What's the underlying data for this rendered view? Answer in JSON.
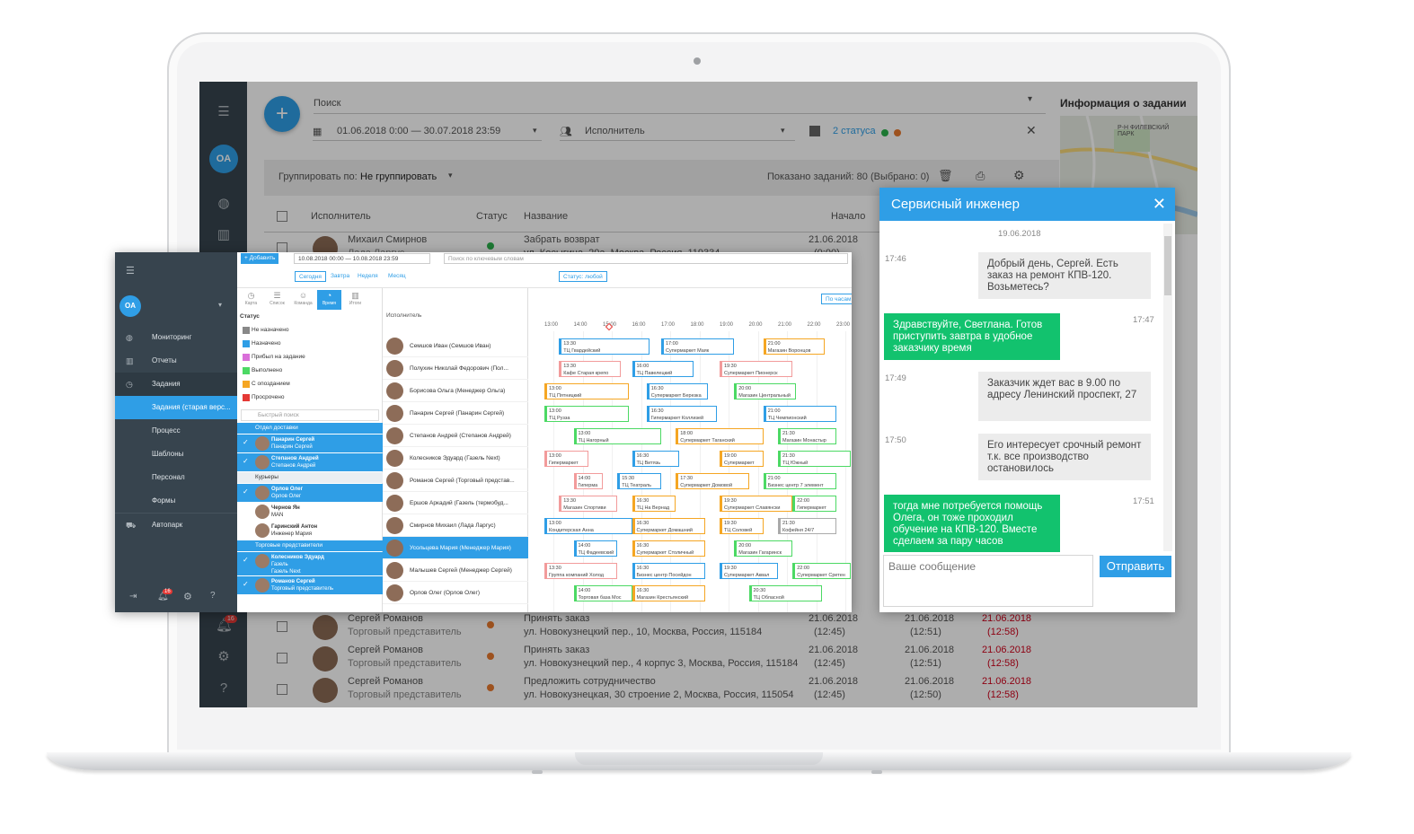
{
  "bg": {
    "avatar_initials": "OA",
    "search_placeholder": "Поиск",
    "date_range": "01.06.2018 0:00 — 30.07.2018 23:59",
    "executor_placeholder": "Исполнитель",
    "status_filter": "2 статуса",
    "group_by_label": "Группировать по:",
    "group_by_value": "Не группировать",
    "shown_count": "Показано заданий: 80 (Выбрано: 0)",
    "columns": {
      "executor": "Исполнитель",
      "status": "Статус",
      "title": "Название",
      "start": "Начало"
    },
    "info_title": "Информация о задании",
    "map_label": "Р-Н ФИЛЕВСКИЙ ПАРК",
    "notif_badge": "16",
    "rows": [
      {
        "name": "Михаил Смирнов",
        "role": "Лада Ларгус",
        "title": "Забрать возврат",
        "address": "ул. Косыгина, 20а, Москва, Россия, 119334",
        "start": "21.06.2018",
        "start_time": "(0:00)",
        "status_color": "#2bb24c"
      },
      {
        "name": "Сергей Романов",
        "role": "Торговый представитель",
        "title": "Принять заказ",
        "address": "ул. Новокузнецкий пер., 10, Москва, Россия, 115184",
        "start": "21.06.2018",
        "start_time": "(12:45)",
        "c2": "21.06.2018",
        "c2_time": "(12:51)",
        "c3": "21.06.2018",
        "c3_time": "(12:58)",
        "status_color": "#e8792e"
      },
      {
        "name": "Сергей Романов",
        "role": "Торговый представитель",
        "title": "Принять заказ",
        "address": "ул. Новокузнецкий пер., 4 корпус 3, Москва, Россия, 115184",
        "start": "21.06.2018",
        "start_time": "(12:45)",
        "c2": "21.06.2018",
        "c2_time": "(12:51)",
        "c3": "21.06.2018",
        "c3_time": "(12:58)",
        "status_color": "#e8792e"
      },
      {
        "name": "Сергей Романов",
        "role": "Торговый представитель",
        "title": "Предложить сотрудничество",
        "address": "ул. Новокузнецкая, 30 строение 2, Москва, Россия, 115054",
        "start": "21.06.2018",
        "start_time": "(12:45)",
        "c2": "21.06.2018",
        "c2_time": "(12:50)",
        "c3": "21.06.2018",
        "c3_time": "(12:58)",
        "status_color": "#e8792e"
      }
    ]
  },
  "win": {
    "avatar_initials": "OA",
    "nav": [
      {
        "label": "Мониторинг",
        "icon": "globe-icon"
      },
      {
        "label": "Отчеты",
        "icon": "chart-icon"
      },
      {
        "label": "Задания",
        "icon": "clock-icon"
      },
      {
        "label": "Задания (старая верс...",
        "icon": ""
      },
      {
        "label": "Процесс",
        "icon": ""
      },
      {
        "label": "Шаблоны",
        "icon": ""
      },
      {
        "label": "Персонал",
        "icon": ""
      },
      {
        "label": "Формы",
        "icon": ""
      },
      {
        "label": "Автопарк",
        "icon": "car-icon"
      }
    ],
    "notif_badge": "16",
    "add_button": "Добавить",
    "date_range": "10.08.2018 00:00 — 10.08.2018 23:59",
    "keyword_placeholder": "Поиск по ключевым словам",
    "quick_dates": [
      "Сегодня",
      "Завтра",
      "Неделя",
      "Месяц"
    ],
    "status_any": "Статус: любой",
    "by_hours": "По часам",
    "view_tabs": [
      "Карта",
      "Список",
      "Команда",
      "Время",
      "Итоги"
    ],
    "status_header": "Статус",
    "statuses": [
      {
        "label": "Не назначено",
        "color": "#888888"
      },
      {
        "label": "Назначено",
        "color": "#2f9ee6"
      },
      {
        "label": "Прибыл на задание",
        "color": "#d96fd9"
      },
      {
        "label": "Выполнено",
        "color": "#4cd964"
      },
      {
        "label": "С опозданием",
        "color": "#f5a623"
      },
      {
        "label": "Просрочено",
        "color": "#e53935"
      }
    ],
    "quick_search": "Быстрый поиск",
    "groups": [
      {
        "title": "Отдел доставки",
        "people": [
          {
            "name": "Панарин Сергей",
            "sub": "Панарин Сергей"
          },
          {
            "name": "Степанов Андрей",
            "sub": "Степанов Андрей"
          }
        ]
      },
      {
        "title": "Курьеры",
        "people": [
          {
            "name": "Орлов Олег",
            "sub": "Орлов Олег"
          },
          {
            "name": "Чернов Ян",
            "sub": "MAN"
          },
          {
            "name": "Гаринский Антон",
            "sub": "Инженер Мария"
          }
        ]
      },
      {
        "title": "Торговые представители",
        "people": [
          {
            "name": "Колесников Эдуард",
            "sub": "Газель",
            "sub2": "Газель Next"
          },
          {
            "name": "Романов Сергей",
            "sub": "Торговый представитель"
          }
        ]
      }
    ],
    "executor_header": "Исполнитель",
    "hours": [
      "13:00",
      "14:00",
      "15:00",
      "16:00",
      "17:00",
      "18:00",
      "19:00",
      "20:00",
      "21:00",
      "22:00",
      "23:00"
    ],
    "executors": [
      "Семшов Иван (Семшов Иван)",
      "Полухин Николай Федорович (Пол...",
      "Борисова Ольга (Менеджер Ольга)",
      "Панарин Сергей (Панарин Сергей)",
      "Степанов Андрей (Степанов Андрей)",
      "Колесников Эдуард (Газель Next)",
      "Романов Сергей (Торговый представ...",
      "Ершов Аркадий (Газель (термобуд...",
      "Смирнов Михаил (Лада Ларгус)",
      "Усольцева Мария (Менеджер Мария)",
      "Малышев Сергей (Менеджер Сергей)",
      "Орлов Олег (Орлов Олег)"
    ],
    "blocks": [
      [
        {
          "t": "13:30",
          "n": "ТЦ Гвардейский",
          "c": "blue",
          "s": 13.5,
          "e": 16.6
        },
        {
          "t": "17:00",
          "n": "Супермаркет Маяк",
          "c": "blue",
          "s": 17.0,
          "e": 19.5
        },
        {
          "t": "21:00",
          "n": "Магазин Воронцов",
          "c": "orange",
          "s": 20.5,
          "e": 22.6
        }
      ],
      [
        {
          "t": "13:30",
          "n": "Кафе Старая крепо",
          "c": "red",
          "s": 13.5,
          "e": 15.6
        },
        {
          "t": "16:00",
          "n": "ТЦ Павелецкий",
          "c": "blue",
          "s": 16.0,
          "e": 18.1
        },
        {
          "t": "19:30",
          "n": "Супермаркет Пионерск",
          "c": "red",
          "s": 19.0,
          "e": 21.5
        }
      ],
      [
        {
          "t": "13:00",
          "n": "ТЦ Пятницкий",
          "c": "orange",
          "s": 13.0,
          "e": 15.9
        },
        {
          "t": "16:30",
          "n": "Супермаркет Березка",
          "c": "blue",
          "s": 16.5,
          "e": 18.6
        },
        {
          "t": "20:00",
          "n": "Магазин Центральный",
          "c": "green",
          "s": 19.5,
          "e": 21.6
        }
      ],
      [
        {
          "t": "13:00",
          "n": "ТЦ Рузза",
          "c": "green",
          "s": 13.0,
          "e": 15.9
        },
        {
          "t": "16:30",
          "n": "Гипермаркет Коллизей",
          "c": "blue",
          "s": 16.5,
          "e": 18.9
        },
        {
          "t": "21:00",
          "n": "ТЦ Чемпионский",
          "c": "blue",
          "s": 20.5,
          "e": 23.0
        }
      ],
      [
        {
          "t": "13:00",
          "n": "ТЦ Нагорный",
          "c": "green",
          "s": 14.0,
          "e": 17.0
        },
        {
          "t": "18:00",
          "n": "Супермаркет Таганский",
          "c": "orange",
          "s": 17.5,
          "e": 20.5
        },
        {
          "t": "21:30",
          "n": "Магазин Монастыр",
          "c": "green",
          "s": 21.0,
          "e": 23.0
        }
      ],
      [
        {
          "t": "13:00",
          "n": "Гипермаркет",
          "c": "red",
          "s": 13.0,
          "e": 14.5
        },
        {
          "t": "16:30",
          "n": "ТЦ Витязь",
          "c": "blue",
          "s": 16.0,
          "e": 17.6
        },
        {
          "t": "19:00",
          "n": "Супермаркет",
          "c": "orange",
          "s": 19.0,
          "e": 20.5
        },
        {
          "t": "21:30",
          "n": "ТЦ Южный",
          "c": "green",
          "s": 21.0,
          "e": 23.5
        }
      ],
      [
        {
          "t": "14:00",
          "n": "Гиперма",
          "c": "red",
          "s": 14.0,
          "e": 15.0
        },
        {
          "t": "15:30",
          "n": "ТЦ Театраль",
          "c": "blue",
          "s": 15.5,
          "e": 17.0
        },
        {
          "t": "17:30",
          "n": "Супермаркет Домовой",
          "c": "orange",
          "s": 17.5,
          "e": 20.0
        },
        {
          "t": "21:00",
          "n": "Бизнес центр 7 элемент",
          "c": "green",
          "s": 20.5,
          "e": 23.0
        }
      ],
      [
        {
          "t": "13:30",
          "n": "Магазин Спортиви",
          "c": "red",
          "s": 13.5,
          "e": 15.5
        },
        {
          "t": "16:30",
          "n": "ТЦ На Вернад",
          "c": "orange",
          "s": 16.0,
          "e": 17.5
        },
        {
          "t": "19:30",
          "n": "Супермаркет Славянски",
          "c": "orange",
          "s": 19.0,
          "e": 21.5
        },
        {
          "t": "22:00",
          "n": "Гипермаркет",
          "c": "green",
          "s": 21.5,
          "e": 23.0
        }
      ],
      [
        {
          "t": "13:00",
          "n": "Кондитерская Анна",
          "c": "blue",
          "s": 13.0,
          "e": 16.0
        },
        {
          "t": "16:30",
          "n": "Супермаркет Домашний",
          "c": "orange",
          "s": 16.0,
          "e": 18.5
        },
        {
          "t": "19:30",
          "n": "ТЦ Соловей",
          "c": "orange",
          "s": 19.0,
          "e": 20.5
        },
        {
          "t": "21:30",
          "n": "Кофейня 24/7",
          "c": "gray",
          "s": 21.0,
          "e": 23.0
        }
      ],
      [
        {
          "t": "14:00",
          "n": "ТЦ Фадеевский",
          "c": "blue",
          "s": 14.0,
          "e": 15.5
        },
        {
          "t": "16:30",
          "n": "Супермаркет Столичный",
          "c": "orange",
          "s": 16.0,
          "e": 18.5
        },
        {
          "t": "20:00",
          "n": "Магазин Гагаринск",
          "c": "green",
          "s": 19.5,
          "e": 21.5
        }
      ],
      [
        {
          "t": "13:30",
          "n": "Группа компаний Холод",
          "c": "red",
          "s": 13.0,
          "e": 15.5
        },
        {
          "t": "16:30",
          "n": "Бизнес центр Посейдон",
          "c": "blue",
          "s": 16.0,
          "e": 18.5
        },
        {
          "t": "19:30",
          "n": "Супермаркет Аквал",
          "c": "blue",
          "s": 19.0,
          "e": 21.0
        },
        {
          "t": "22:00",
          "n": "Супермаркет Сретен",
          "c": "green",
          "s": 21.5,
          "e": 23.5
        }
      ],
      [
        {
          "t": "14:00",
          "n": "Торговая база Мос",
          "c": "green",
          "s": 14.0,
          "e": 16.0
        },
        {
          "t": "16:30",
          "n": "Магазин Крестьянский",
          "c": "orange",
          "s": 16.0,
          "e": 18.5
        },
        {
          "t": "20:30",
          "n": "ТЦ Облаcной",
          "c": "green",
          "s": 20.0,
          "e": 22.5
        }
      ]
    ]
  },
  "chat": {
    "title": "Сервисный инженер",
    "date": "19.06.2018",
    "messages": [
      {
        "dir": "in",
        "time": "17:46",
        "text": "Добрый день, Сергей. Есть заказ на ремонт КПВ-120. Возьметесь?"
      },
      {
        "dir": "out",
        "time": "17:47",
        "text": "Здравствуйте, Светлана. Готов приступить завтра в удобное заказчику время"
      },
      {
        "dir": "in",
        "time": "17:49",
        "text": "Заказчик ждет вас в 9.00 по адресу Ленинский проспект, 27"
      },
      {
        "dir": "in",
        "time": "17:50",
        "text": "Его интересует срочный ремонт т.к. все производство остановилось"
      },
      {
        "dir": "out",
        "time": "17:51",
        "text": "тогда мне потребуется помощь Олега, он тоже проходил обучение на КПВ-120. Вместе сделаем за пару часов"
      }
    ],
    "input_placeholder": "Ваше сообщение",
    "send_label": "Отправить"
  }
}
